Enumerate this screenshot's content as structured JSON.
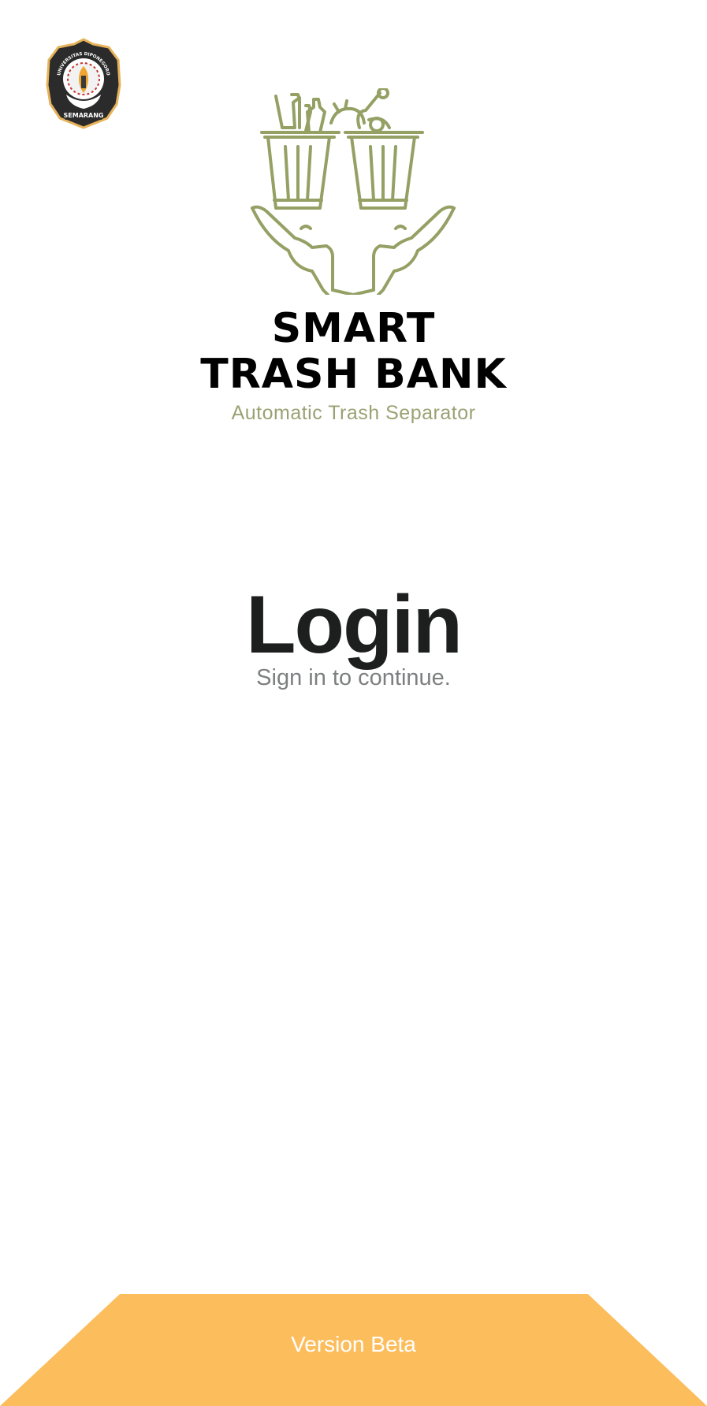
{
  "header": {
    "university_logo": {
      "icon": "university-seal-icon",
      "arc_text_top": "UNIVERSITAS DIPONEGORO",
      "banner_text": "SEMARANG"
    },
    "app_logo": {
      "icon": "trash-bins-hands-icon"
    }
  },
  "brand": {
    "title_line1": "SMART",
    "title_line2": "TRASH BANK",
    "subtitle": "Automatic Trash Separator"
  },
  "login": {
    "title": "Login",
    "subtitle": "Sign in to continue."
  },
  "footer": {
    "version_label": "Version Beta"
  },
  "colors": {
    "accent_green": "#94a064",
    "subtitle_green": "#9aa274",
    "footer_orange": "#fcbd5d",
    "title_dark": "#1d1f1e",
    "muted_gray": "#7d7f80"
  }
}
